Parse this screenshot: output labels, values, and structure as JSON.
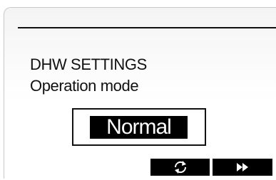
{
  "screen": {
    "title": "DHW SETTINGS",
    "subtitle": "Operation mode",
    "selected_value": "Normal"
  },
  "softkeys": [
    {
      "icon": "cycle-arrows-icon"
    },
    {
      "icon": "fast-forward-icon"
    }
  ],
  "colors": {
    "background": "#ffffff",
    "foreground": "#111111",
    "highlight": "#000000",
    "highlight_text": "#ffffff"
  }
}
